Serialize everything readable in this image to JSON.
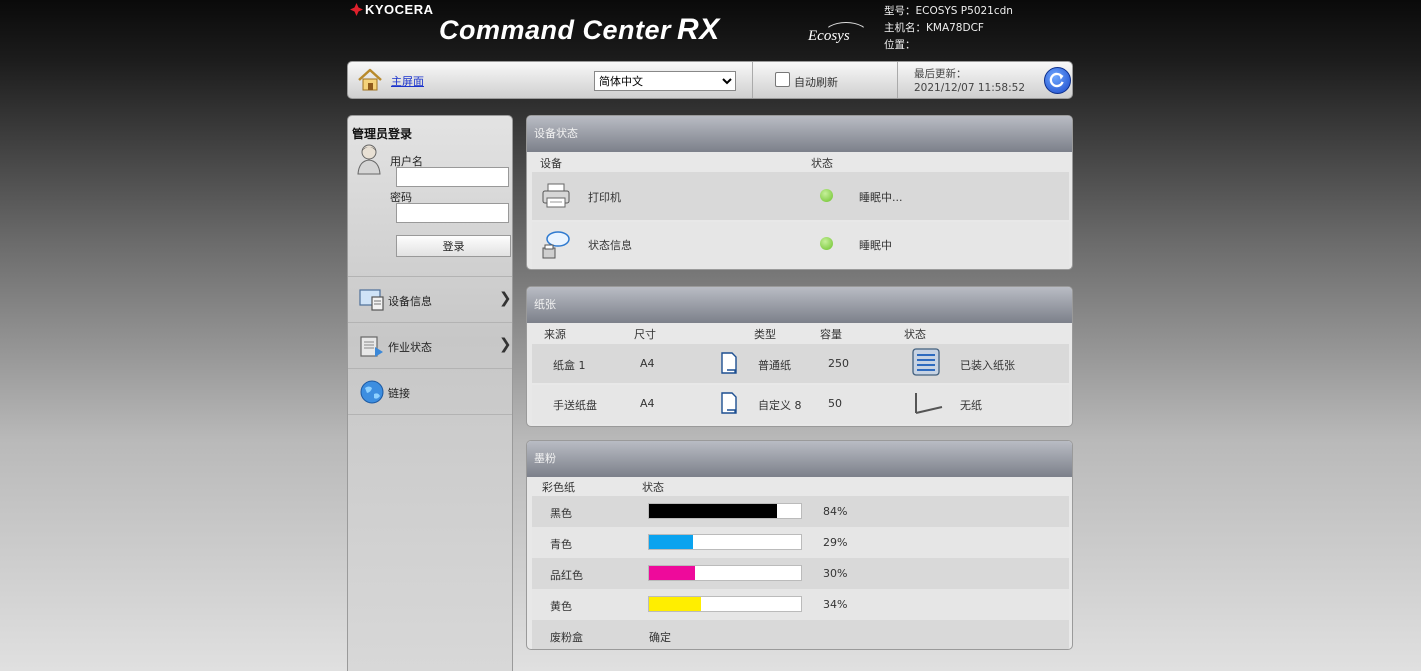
{
  "header": {
    "brand": "KYOCERA",
    "app_title": "Command Center",
    "app_title_suffix": "RX",
    "ecosys_logo": "Ecosys",
    "model_label": "型号：ECOSYS P5021cdn",
    "hostname_label": "主机名：KMA78DCF",
    "location_label": "位置："
  },
  "toolbar": {
    "home_label": "主屏面",
    "language_selected": "简体中文",
    "auto_refresh_label": "自动刷新",
    "last_updated_label": "最后更新：",
    "last_updated_value": "2021/12/07 11:58:52"
  },
  "sidebar": {
    "login_title": "管理员登录",
    "username_label": "用户名",
    "username_value": "",
    "password_label": "密码",
    "password_value": "",
    "login_button": "登录",
    "items": [
      {
        "label": "设备信息",
        "icon": "device-info-icon"
      },
      {
        "label": "作业状态",
        "icon": "job-status-icon"
      },
      {
        "label": "链接",
        "icon": "globe-icon"
      }
    ]
  },
  "device_status": {
    "title": "设备状态",
    "col_device": "设备",
    "col_status": "状态",
    "rows": [
      {
        "device": "打印机",
        "status": "睡眠中...",
        "icon": "printer-icon",
        "indicator_color": "#6cc12b"
      },
      {
        "device": "状态信息",
        "status": "睡眠中",
        "icon": "status-message-icon",
        "indicator_color": "#6cc12b"
      }
    ]
  },
  "paper": {
    "title": "纸张",
    "col_source": "来源",
    "col_size": "尺寸",
    "col_type": "类型",
    "col_capacity": "容量",
    "col_status": "状态",
    "rows": [
      {
        "source": "纸盒 1",
        "size": "A4",
        "type": "普通纸",
        "capacity": "250",
        "status": "已装入纸张",
        "status_icon": "paper-stack-icon"
      },
      {
        "source": "手送纸盘",
        "size": "A4",
        "type": "自定义 8",
        "capacity": "50",
        "status": "无纸",
        "status_icon": "empty-tray-icon"
      }
    ]
  },
  "toner": {
    "title": "墨粉",
    "col_color": "彩色纸",
    "col_status": "状态",
    "rows": [
      {
        "color": "黑色",
        "level": 84,
        "label": "84%",
        "fill": "#000000"
      },
      {
        "color": "青色",
        "level": 29,
        "label": "29%",
        "fill": "#0aa3ef"
      },
      {
        "color": "品红色",
        "level": 30,
        "label": "30%",
        "fill": "#ee0a9b"
      },
      {
        "color": "黄色",
        "level": 34,
        "label": "34%",
        "fill": "#ffee00"
      }
    ],
    "waste_label": "废粉盒",
    "waste_status": "确定"
  }
}
